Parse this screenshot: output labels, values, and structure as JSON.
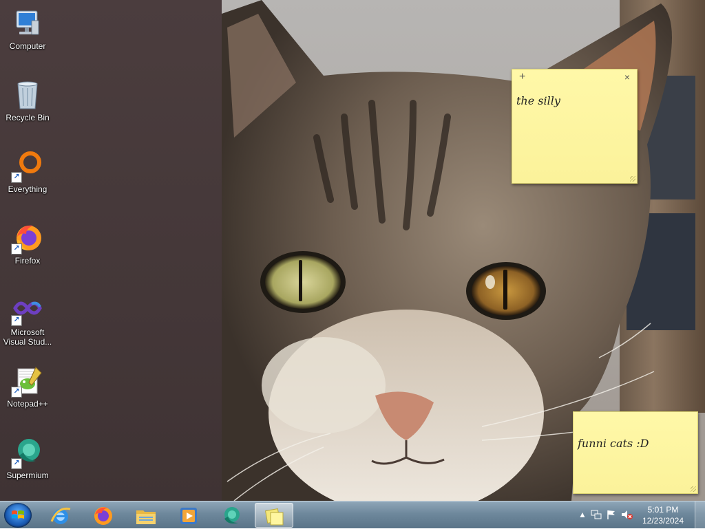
{
  "desktop": {
    "icons": [
      {
        "label": "Computer",
        "icon": "computer-icon"
      },
      {
        "label": "Recycle Bin",
        "icon": "recycle-bin-icon"
      },
      {
        "label": "Everything",
        "icon": "everything-icon"
      },
      {
        "label": "Firefox",
        "icon": "firefox-icon"
      },
      {
        "label": "Microsoft Visual Stud...",
        "icon": "visual-studio-icon"
      },
      {
        "label": "Notepad++",
        "icon": "notepad-plus-plus-icon"
      },
      {
        "label": "Supermium",
        "icon": "supermium-icon"
      }
    ]
  },
  "sticky_notes": [
    {
      "text": "the silly",
      "add_glyph": "+",
      "close_glyph": "×"
    },
    {
      "text": "funni cats :D"
    }
  ],
  "taskbar": {
    "start": {
      "icon": "windows-start-icon"
    },
    "pinned": [
      {
        "icon": "internet-explorer-icon"
      },
      {
        "icon": "firefox-icon"
      },
      {
        "icon": "file-explorer-icon"
      },
      {
        "icon": "media-player-icon"
      },
      {
        "icon": "supermium-icon"
      },
      {
        "icon": "sticky-notes-icon",
        "active": true
      }
    ],
    "tray": {
      "icons": [
        "show-hidden-icons-icon",
        "network-icon",
        "action-center-flag-icon",
        "volume-muted-icon"
      ],
      "time": "5:01 PM",
      "date": "12/23/2024"
    }
  },
  "colors": {
    "sticky_yellow": "#fbf29a",
    "taskbar": "#6e889c",
    "wallpaper_dark": "#3f3334"
  }
}
